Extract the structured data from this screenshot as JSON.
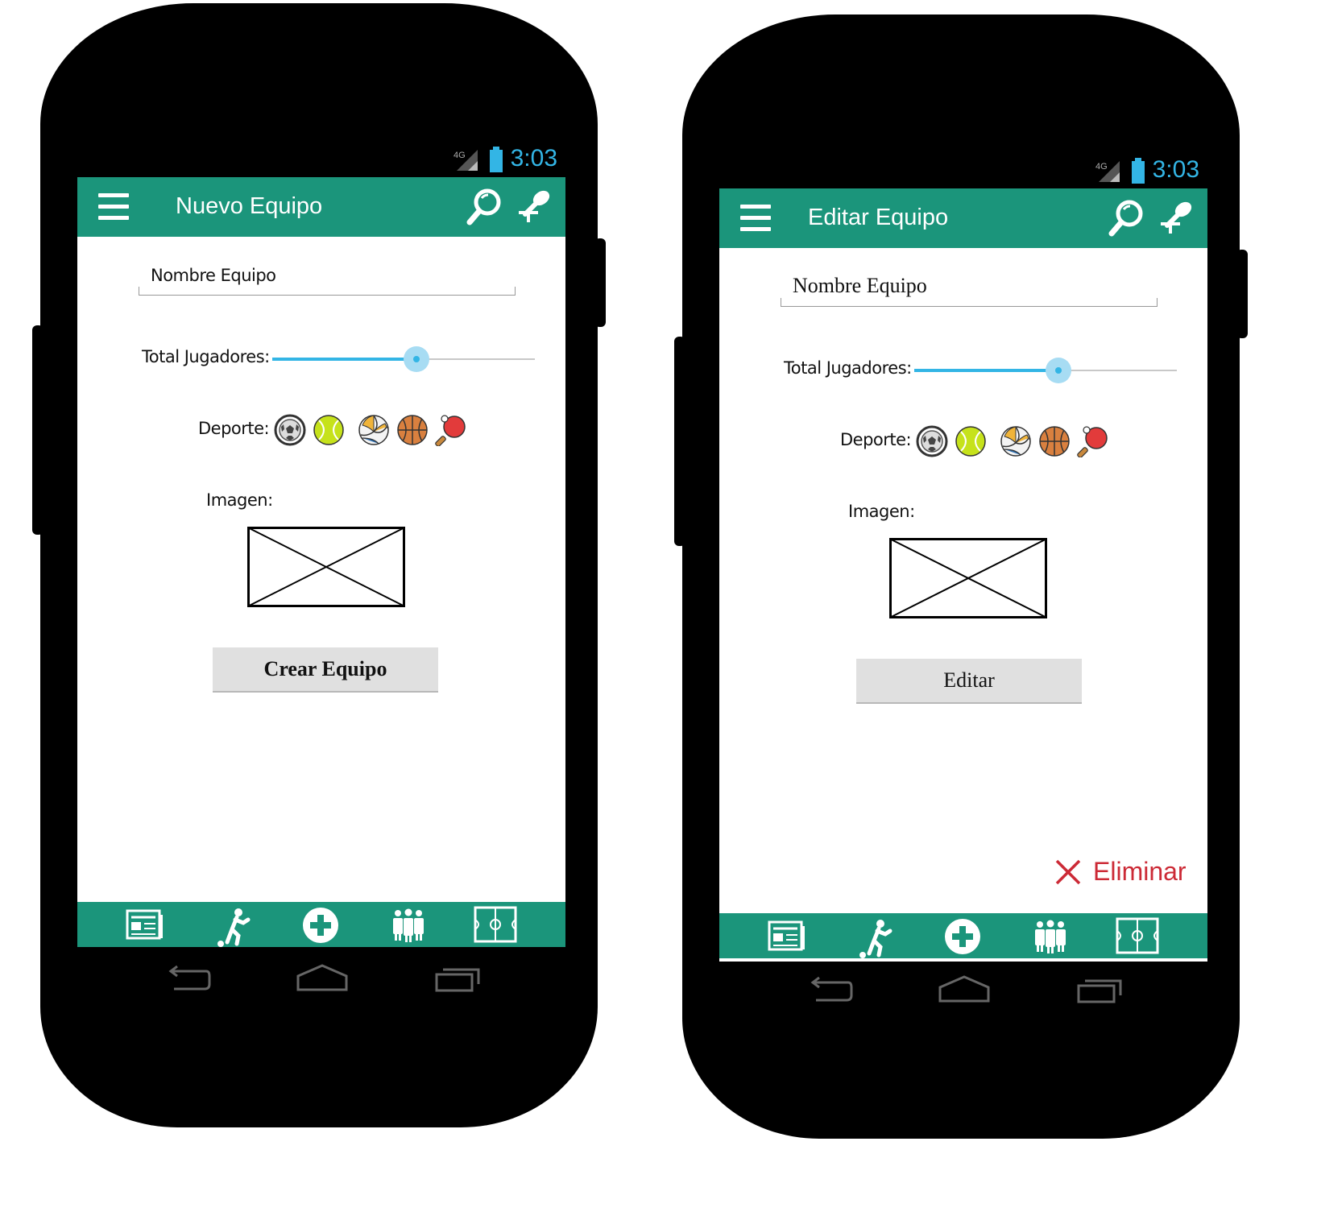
{
  "colors": {
    "appbar": "#1b957b",
    "accent": "#33b5e5",
    "danger": "#cc2a36"
  },
  "screens": [
    {
      "status": {
        "network": "4G",
        "time": "3:03"
      },
      "appbar": {
        "title": "Nuevo Equipo",
        "menu_icon": "hamburger-menu-icon",
        "search_icon": "search-icon",
        "mic_icon": "microphone-icon"
      },
      "form": {
        "name_label": "Nombre Equipo",
        "players_label": "Total Jugadores:",
        "players_slider": {
          "fraction": 0.55
        },
        "sport_label": "Deporte:",
        "sports": [
          "soccer-ball-icon",
          "tennis-ball-icon",
          "volleyball-icon",
          "basketball-icon",
          "ping-pong-paddle-icon"
        ],
        "image_label": "Imagen:",
        "image_placeholder_icon": "image-placeholder-icon",
        "submit_label": "Crear Equipo"
      },
      "bottom_nav": [
        "news-icon",
        "player-icon",
        "add-icon",
        "teams-icon",
        "field-icon"
      ]
    },
    {
      "status": {
        "network": "4G",
        "time": "3:03"
      },
      "appbar": {
        "title": "Editar Equipo",
        "menu_icon": "hamburger-menu-icon",
        "search_icon": "search-icon",
        "mic_icon": "microphone-icon"
      },
      "form": {
        "name_label": "Nombre Equipo",
        "players_label": "Total Jugadores:",
        "players_slider": {
          "fraction": 0.55
        },
        "sport_label": "Deporte:",
        "sports": [
          "soccer-ball-icon",
          "tennis-ball-icon",
          "volleyball-icon",
          "basketball-icon",
          "ping-pong-paddle-icon"
        ],
        "image_label": "Imagen:",
        "image_placeholder_icon": "image-placeholder-icon",
        "submit_label": "Editar"
      },
      "delete_label": "Eliminar",
      "bottom_nav": [
        "news-icon",
        "player-icon",
        "add-icon",
        "teams-icon",
        "field-icon"
      ]
    }
  ]
}
